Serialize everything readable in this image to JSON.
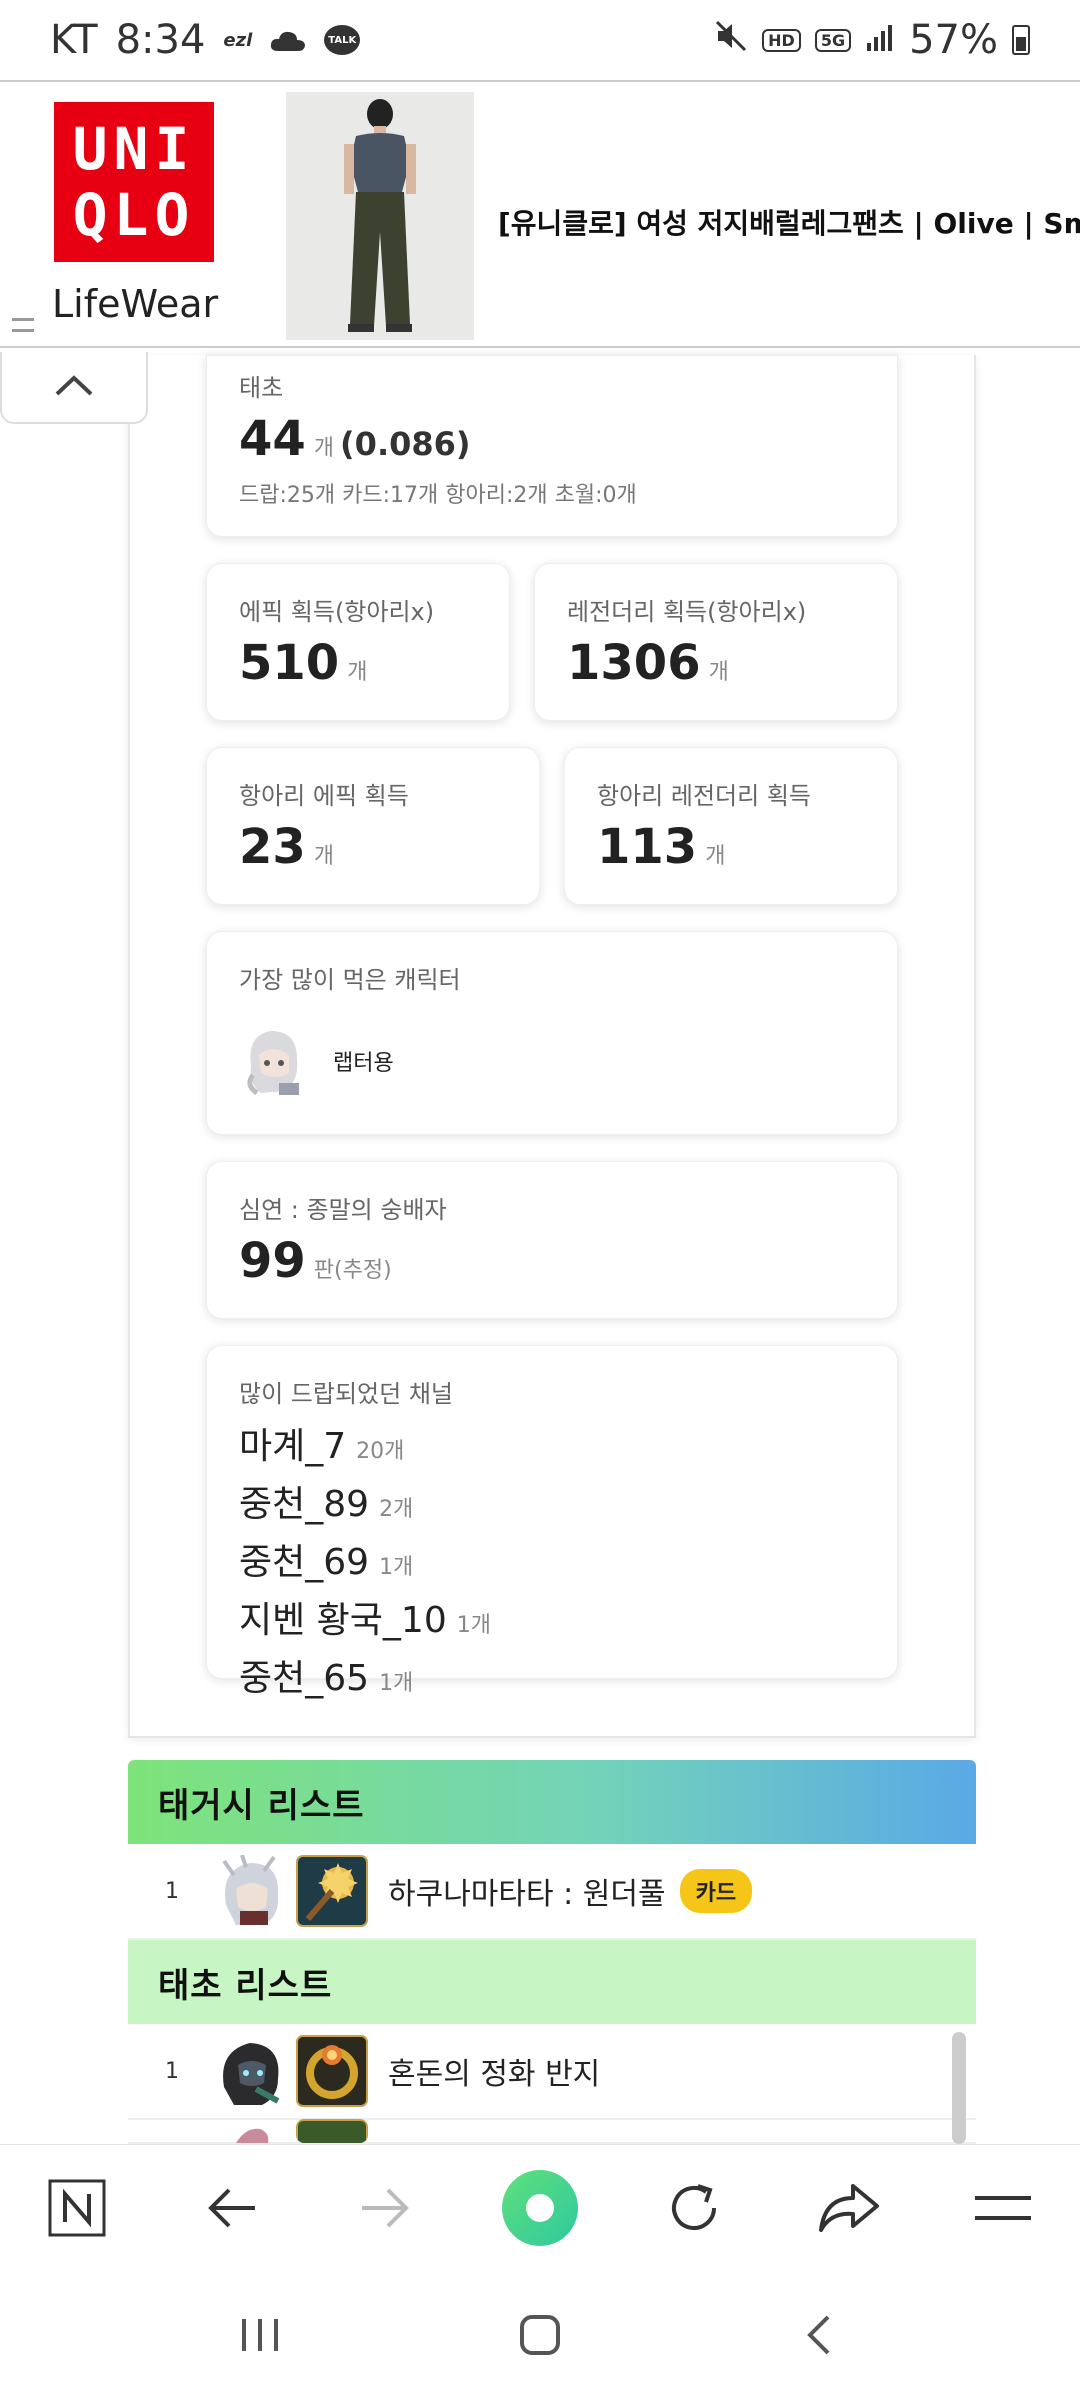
{
  "status_bar": {
    "carrier": "KT",
    "time": "8:34",
    "ezl_label": "ezl",
    "talk_label": "TALK",
    "hd_label": "HD",
    "network": "5G",
    "battery": "57%"
  },
  "ad": {
    "brand_top": "UNI",
    "brand_bottom": "QLO",
    "tagline": "LifeWear",
    "title": "[유니클로] 여성 저지배럴레그팬츠 | Olive | Small"
  },
  "cards": {
    "taecho": {
      "label": "태초",
      "value": "44",
      "unit": "개",
      "ratio": "(0.086)",
      "breakdown": "드랍:25개 카드:17개 항아리:2개 초월:0개"
    },
    "epic": {
      "label": "에픽 획득(항아리x)",
      "value": "510",
      "unit": "개"
    },
    "legendary": {
      "label": "레전더리 획득(항아리x)",
      "value": "1306",
      "unit": "개"
    },
    "pot_epic": {
      "label": "항아리 에픽 획득",
      "value": "23",
      "unit": "개"
    },
    "pot_legendary": {
      "label": "항아리 레전더리 획득",
      "value": "113",
      "unit": "개"
    },
    "top_character": {
      "label": "가장 많이 먹은 캐릭터",
      "name": "랩터용"
    },
    "abyss": {
      "label": "심연 : 종말의 숭배자",
      "value": "99",
      "unit": "판(추정)"
    },
    "channels": {
      "label": "많이 드랍되었던 채널",
      "items": [
        {
          "name": "마계_7",
          "count": "20개"
        },
        {
          "name": "중천_89",
          "count": "2개"
        },
        {
          "name": "중천_69",
          "count": "1개"
        },
        {
          "name": "지벤 황국_10",
          "count": "1개"
        },
        {
          "name": "중천_65",
          "count": "1개"
        }
      ]
    }
  },
  "lists": {
    "taegeosi": {
      "title": "태거시 리스트",
      "rows": [
        {
          "rank": "1",
          "name": "하쿠나마타타 : 원더풀",
          "badge": "카드"
        }
      ]
    },
    "taecho": {
      "title": "태초 리스트",
      "rows": [
        {
          "rank": "1",
          "name": "혼돈의 정화 반지"
        }
      ]
    }
  },
  "colors": {
    "uniqlo_red": "#e60012",
    "header_gradient": [
      "#7ee37a",
      "#73d3b9",
      "#5aa9e6"
    ],
    "taecho_header": "#c8f5c4",
    "badge": "#f5c518",
    "home_ring": "#5fe07a"
  }
}
